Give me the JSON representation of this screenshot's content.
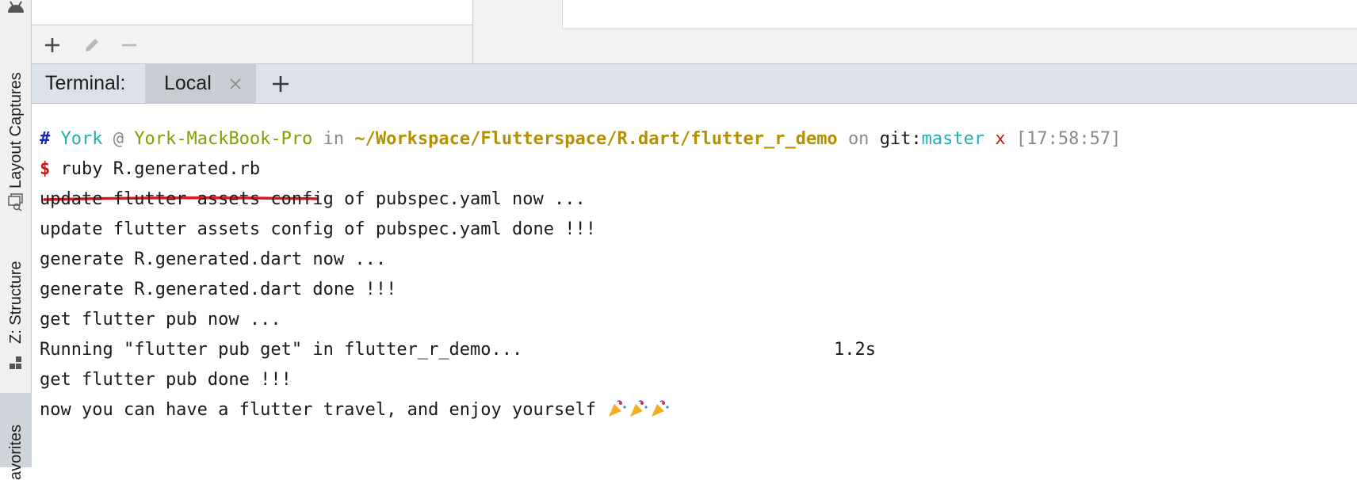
{
  "sidebar": {
    "tabs": [
      {
        "label": "Layout Captures"
      },
      {
        "label": "Z: Structure"
      },
      {
        "label": "avorites"
      }
    ]
  },
  "toolbar": {
    "buttons": [
      {
        "icon": "plus-icon"
      },
      {
        "icon": "pencil-icon"
      },
      {
        "icon": "minus-icon"
      }
    ]
  },
  "terminal_tabs": {
    "title": "Terminal:",
    "tabs": [
      {
        "label": "Local",
        "active": true
      }
    ],
    "new_tab_icon": "plus-icon"
  },
  "terminal": {
    "prompt": {
      "hash": "#",
      "user": "York",
      "at": "@",
      "host": "York-MackBook-Pro",
      "in": "in",
      "path": "~/Workspace/Flutterspace/R.dart/flutter_r_demo",
      "on": "on",
      "git_label": "git:",
      "branch": "master",
      "dirty": "x",
      "time": "[17:58:57]"
    },
    "command": {
      "dollar": "$",
      "text": "ruby R.generated.rb"
    },
    "output": [
      "update flutter assets config of pubspec.yaml now ...",
      "update flutter assets config of pubspec.yaml done !!!",
      "generate R.generated.dart now ...",
      "generate R.generated.dart done !!!",
      "get flutter pub now ...",
      "Running \"flutter pub get\" in flutter_r_demo...",
      "get flutter pub done !!!",
      "now you can have a flutter travel, and enjoy yourself"
    ],
    "timing": "1.2s",
    "emoji": [
      "party-popper-icon",
      "party-popper-icon",
      "party-popper-icon"
    ]
  },
  "colors": {
    "accent_red": "#c41a16",
    "user_cyan": "#1fb0b4",
    "path_gold": "#b49000",
    "hash_blue": "#1a23b8"
  }
}
